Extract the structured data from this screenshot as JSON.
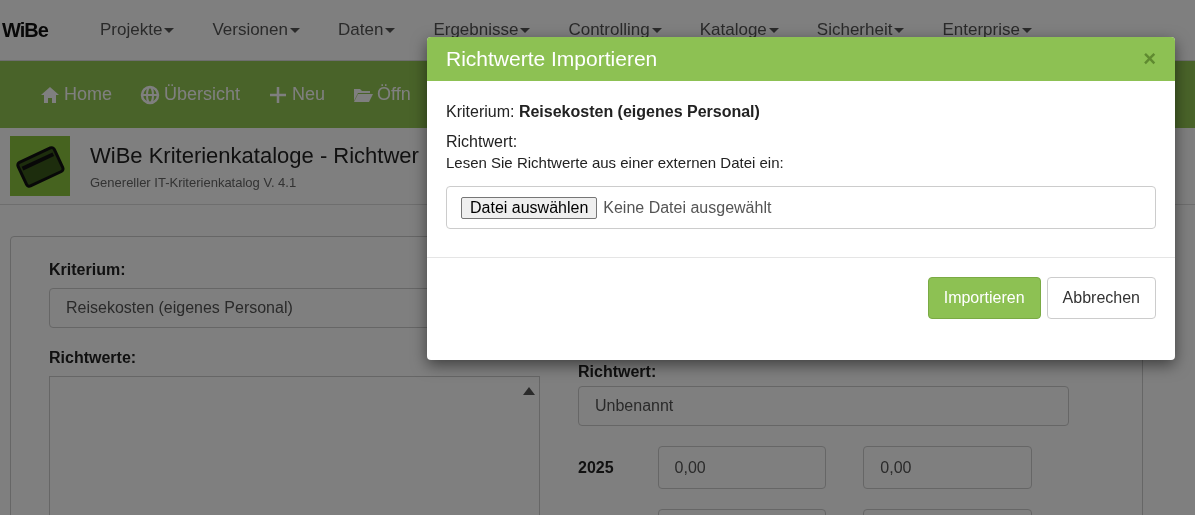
{
  "navbar": {
    "logo": "WiBe",
    "menu": [
      {
        "label": "Projekte"
      },
      {
        "label": "Versionen"
      },
      {
        "label": "Daten"
      },
      {
        "label": "Ergebnisse"
      },
      {
        "label": "Controlling"
      },
      {
        "label": "Kataloge"
      },
      {
        "label": "Sicherheit"
      },
      {
        "label": "Enterprise"
      }
    ]
  },
  "toolbar": [
    {
      "label": "Home",
      "kind": "home"
    },
    {
      "label": "Übersicht",
      "kind": "globe"
    },
    {
      "label": "Neu",
      "kind": "plus"
    },
    {
      "label": "Öffn",
      "kind": "folder"
    }
  ],
  "header": {
    "title": "WiBe Kriterienkataloge - Richtwer",
    "subtitle": "Genereller IT-Kriterienkatalog V. 4.1"
  },
  "form": {
    "kriterium_label": "Kriterium:",
    "kriterium_value": "Reisekosten (eigenes Personal)",
    "richtwerte_label": "Richtwerte:",
    "richtwert_label": "Richtwert:",
    "richtwert_value": "Unbenannt",
    "rows": [
      {
        "year": "2025",
        "fields": [
          {
            "value": "0,00"
          },
          {
            "value": "0,00"
          }
        ]
      },
      {
        "fields": [
          {
            "kind": "input"
          },
          {
            "kind": "input"
          }
        ]
      }
    ]
  },
  "modal": {
    "title": "Richtwerte Importieren",
    "close": "×",
    "kriterium": "Kriterium: **Reisekosten (eigenes Personal)**",
    "richtwert": "Richtwert:",
    "instruction": "Lesen Sie Richtwerte aus einer externen Datei ein:",
    "file_button": "Datei auswählen",
    "file_status": "Keine Datei ausgewählt",
    "buttons": [
      {
        "label": "Importieren",
        "kind": "primary"
      },
      {
        "label": "Abbrechen",
        "kind": "default"
      }
    ]
  }
}
